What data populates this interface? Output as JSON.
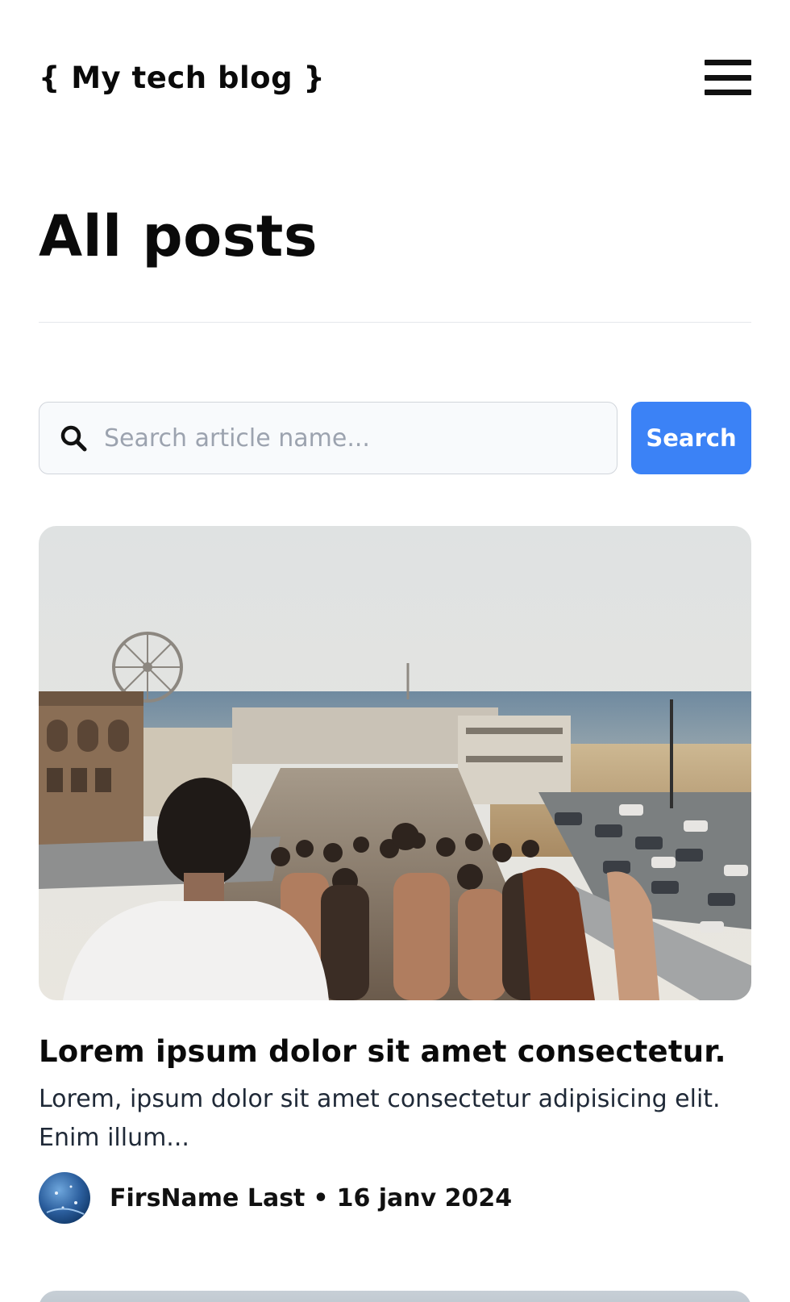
{
  "header": {
    "logo": "{ My tech blog }",
    "menu_icon": "hamburger-menu-icon"
  },
  "page": {
    "title": "All posts"
  },
  "search": {
    "icon": "search-icon",
    "placeholder": "Search article name...",
    "value": "",
    "button_label": "Search"
  },
  "colors": {
    "accent": "#3b82f6",
    "text": "#0a0a0a",
    "divider": "#e5e7eb"
  },
  "posts": [
    {
      "image": "pier-boardwalk-crowd-photo",
      "title": "Lorem ipsum dolor sit amet consectetur.",
      "excerpt": "Lorem, ipsum dolor sit amet consectetur adipisicing elit. Enim illum...",
      "author": "FirsName Last",
      "separator": "•",
      "date": "16 janv 2024"
    }
  ]
}
